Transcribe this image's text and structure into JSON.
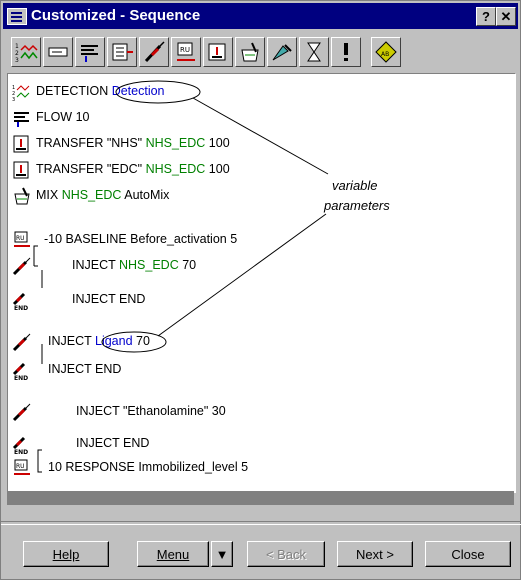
{
  "window": {
    "title": "Customized - Sequence",
    "help_btn": "?",
    "close_btn": "✕"
  },
  "toolbar": {
    "tools": [
      "detection-tool",
      "flow-tool",
      "transfer-tool",
      "inject-tool",
      "sample-tool",
      "baseline-tool",
      "transfer-alt-tool",
      "mix-tool",
      "wash-tool",
      "wait-tool",
      "exclaim-tool",
      "ab-tool"
    ]
  },
  "sequence": {
    "rows": [
      {
        "pre": "DETECTION ",
        "param": "Detection",
        "post": "",
        "param_color": "blue"
      },
      {
        "pre": "FLOW 10",
        "param": "",
        "post": ""
      },
      {
        "pre": "TRANSFER \"NHS\" ",
        "param": "NHS_EDC",
        "post": " 100",
        "param_color": "green"
      },
      {
        "pre": "TRANSFER \"EDC\" ",
        "param": "NHS_EDC",
        "post": " 100",
        "param_color": "green"
      },
      {
        "pre": "MIX ",
        "param": "NHS_EDC",
        "post": " AutoMix",
        "param_color": "green"
      },
      {
        "pre": "-10 BASELINE Before_activation 5",
        "param": "",
        "post": ""
      },
      {
        "pre": "INJECT ",
        "param": "NHS_EDC",
        "post": " 70",
        "param_color": "green"
      },
      {
        "pre": "INJECT END",
        "param": "",
        "post": ""
      },
      {
        "pre": "INJECT ",
        "param": "Ligand",
        "post": " 70",
        "param_color": "blue"
      },
      {
        "pre": "INJECT END",
        "param": "",
        "post": ""
      },
      {
        "pre": "INJECT \"Ethanolamine\" 30",
        "param": "",
        "post": ""
      },
      {
        "pre": "INJECT END",
        "param": "",
        "post": ""
      },
      {
        "pre": "10 RESPONSE Immobilized_level 5",
        "param": "",
        "post": ""
      }
    ]
  },
  "annotation": {
    "line1": "variable",
    "line2": "parameters"
  },
  "buttons": {
    "help": "Help",
    "menu": "Menu",
    "back": "< Back",
    "next": "Next >",
    "close": "Close"
  }
}
